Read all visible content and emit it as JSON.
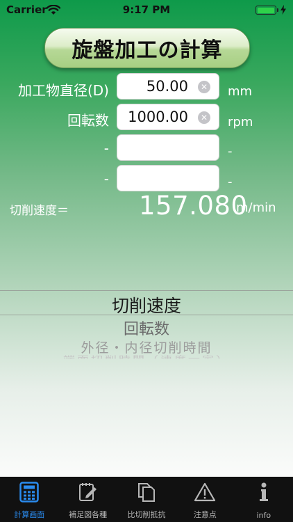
{
  "status_bar": {
    "carrier": "Carrier",
    "time": "9:17 PM"
  },
  "title": "旋盤加工の計算",
  "form": {
    "rows": [
      {
        "label": "加工物直径(D)",
        "value": "50.00",
        "unit": "mm"
      },
      {
        "label": "回転数",
        "value": "1000.00",
        "unit": "rpm"
      },
      {
        "label": "-",
        "value": "",
        "unit": "-"
      },
      {
        "label": "-",
        "value": "",
        "unit": "-"
      }
    ]
  },
  "result": {
    "label": "切削速度＝",
    "value": "157.080",
    "unit": "m/min"
  },
  "picker": {
    "items": [
      "切削速度",
      "回転数",
      "外径・内径切削時間",
      "端面切削時間（速度一定）"
    ],
    "selected_index": 0
  },
  "tab_bar": {
    "active_index": 0,
    "tabs": [
      {
        "label": "計算画面",
        "icon": "calculator-icon"
      },
      {
        "label": "補足図各種",
        "icon": "edit-document-icon"
      },
      {
        "label": "比切削抵抗",
        "icon": "copy-documents-icon"
      },
      {
        "label": "注意点",
        "icon": "warning-icon"
      },
      {
        "label": "info",
        "icon": "info-icon"
      }
    ]
  },
  "colors": {
    "accent": "#2a8cf0",
    "battery": "#2fd14a",
    "background_top": "#0e9a4a"
  }
}
